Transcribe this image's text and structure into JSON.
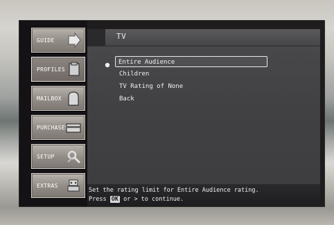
{
  "screen": {
    "title": "TV"
  },
  "nav": {
    "items": [
      {
        "label": "GUIDE",
        "icon": "arrow-right-icon"
      },
      {
        "label": "PROFILES",
        "icon": "profile-card-icon"
      },
      {
        "label": "MAILBOX",
        "icon": "mailbox-icon"
      },
      {
        "label": "PURCHASES",
        "icon": "purchase-card-icon"
      },
      {
        "label": "SETUP",
        "icon": "setup-tools-icon"
      },
      {
        "label": "EXTRAS",
        "icon": "extras-robot-icon"
      }
    ],
    "active_index": 1
  },
  "options": {
    "items": [
      "Entire Audience",
      "Children",
      "TV Rating of None",
      "Back"
    ],
    "selected_index": 0
  },
  "help": {
    "line1": "Set the rating limit for Entire Audience rating.",
    "line2_pre": "Press ",
    "line2_key": "OK",
    "line2_post": " or > to continue."
  },
  "colors": {
    "panel": "#1e1c1d",
    "content": "#434345",
    "nav_button": "#948e88",
    "text": "#f1f1f1"
  }
}
